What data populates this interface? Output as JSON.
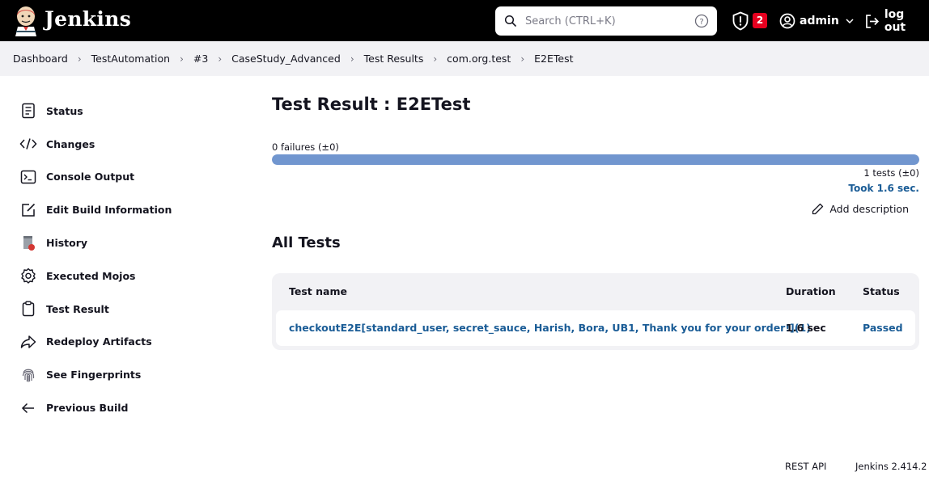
{
  "header": {
    "brand": "Jenkins",
    "search_placeholder": "Search (CTRL+K)",
    "security_badge_count": "2",
    "user_name": "admin",
    "logout_label": "log out",
    "background_color": "#000000"
  },
  "breadcrumb": [
    "Dashboard",
    "TestAutomation",
    "#3",
    "CaseStudy_Advanced",
    "Test Results",
    "com.org.test",
    "E2ETest"
  ],
  "sidebar": {
    "items": [
      {
        "label": "Status",
        "icon": "status-icon"
      },
      {
        "label": "Changes",
        "icon": "code-icon"
      },
      {
        "label": "Console Output",
        "icon": "terminal-icon"
      },
      {
        "label": "Edit Build Information",
        "icon": "edit-icon"
      },
      {
        "label": "History",
        "icon": "history-icon"
      },
      {
        "label": "Executed Mojos",
        "icon": "gear-icon"
      },
      {
        "label": "Test Result",
        "icon": "clipboard-icon"
      },
      {
        "label": "Redeploy Artifacts",
        "icon": "redeploy-icon"
      },
      {
        "label": "See Fingerprints",
        "icon": "fingerprint-icon"
      },
      {
        "label": "Previous Build",
        "icon": "arrow-left-icon"
      }
    ]
  },
  "main": {
    "title": "Test Result : E2ETest",
    "failures_text": "0 failures (±0)",
    "pass_fraction": 1.0,
    "tests_text": "1 tests (±0)",
    "took_text": "Took 1.6 sec.",
    "add_description_label": "Add description",
    "all_tests_heading": "All Tests",
    "table": {
      "headers": {
        "name": "Test name",
        "duration": "Duration",
        "status": "Status"
      },
      "rows": [
        {
          "name": "checkoutE2E[standard_user, secret_sauce, Harish, Bora, UB1, Thank you for your order!](1)",
          "duration": "1.6 sec",
          "status": "Passed"
        }
      ]
    },
    "progress_color": "#7196cf",
    "link_color": "#1a5c96"
  },
  "footer": {
    "rest_api": "REST API",
    "version": "Jenkins 2.414.2"
  }
}
